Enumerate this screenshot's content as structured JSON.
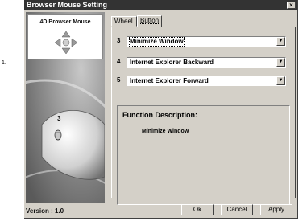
{
  "window": {
    "title": "Browser Mouse Setting",
    "close_glyph": "×"
  },
  "left_panel": {
    "logo_title": "4D Browser Mouse",
    "button_number": "3",
    "version": "Version : 1.0"
  },
  "tabs": [
    {
      "label": "Wheel",
      "selected": false
    },
    {
      "label": "Button",
      "selected": true
    }
  ],
  "buttons_config": [
    {
      "number": "3",
      "value": "Minimize Window"
    },
    {
      "number": "4",
      "value": "Internet Explorer Backward"
    },
    {
      "number": "5",
      "value": "Internet Explorer Forward"
    }
  ],
  "description": {
    "title": "Function Description:",
    "text": "Minimize Window"
  },
  "footer": {
    "ok_label": "Ok",
    "cancel_label": "Cancel",
    "apply_label": "Apply"
  },
  "margin_mark": "1.",
  "colors": {
    "face": "#d4d0c8",
    "titlebar": "#333333",
    "panel_gray": "#8a8a8a"
  }
}
